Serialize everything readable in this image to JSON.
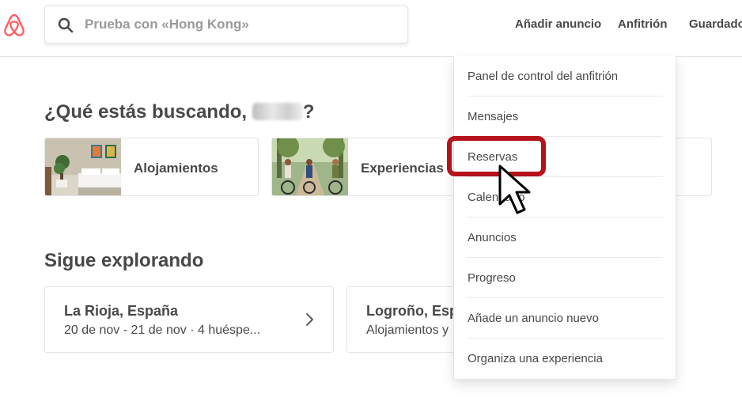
{
  "header": {
    "logo_icon": "airbnb-logo-icon",
    "search": {
      "placeholder": "Prueba con «Hong Kong»",
      "value": "",
      "icon": "search-icon"
    },
    "nav": [
      "Añadir anuncio",
      "Anfitrión",
      "Guardado"
    ]
  },
  "main": {
    "greeting": {
      "prefix": "¿Qué estás buscando, ",
      "suffix": "?"
    },
    "categories": [
      {
        "label": "Alojamientos"
      },
      {
        "label": "Experiencias"
      },
      {
        "label": ""
      }
    ],
    "explore_title": "Sigue explorando",
    "explore_cards": [
      {
        "title": "La Rioja, España",
        "subtitle": "20 de nov - 21 de nov · 4 huéspe..."
      },
      {
        "title": "Logroño, Esp",
        "subtitle": "Alojamientos y"
      }
    ]
  },
  "dropdown": {
    "items": [
      "Panel de control del anfitrión",
      "Mensajes",
      "Reservas",
      "Calendario",
      "Anuncios",
      "Progreso",
      "Añade un anuncio nuevo",
      "Organiza una experiencia"
    ],
    "highlighted": "Reservas"
  },
  "colors": {
    "brand": "#FF5A5F",
    "highlight": "#B5121B",
    "text": "#484848"
  }
}
